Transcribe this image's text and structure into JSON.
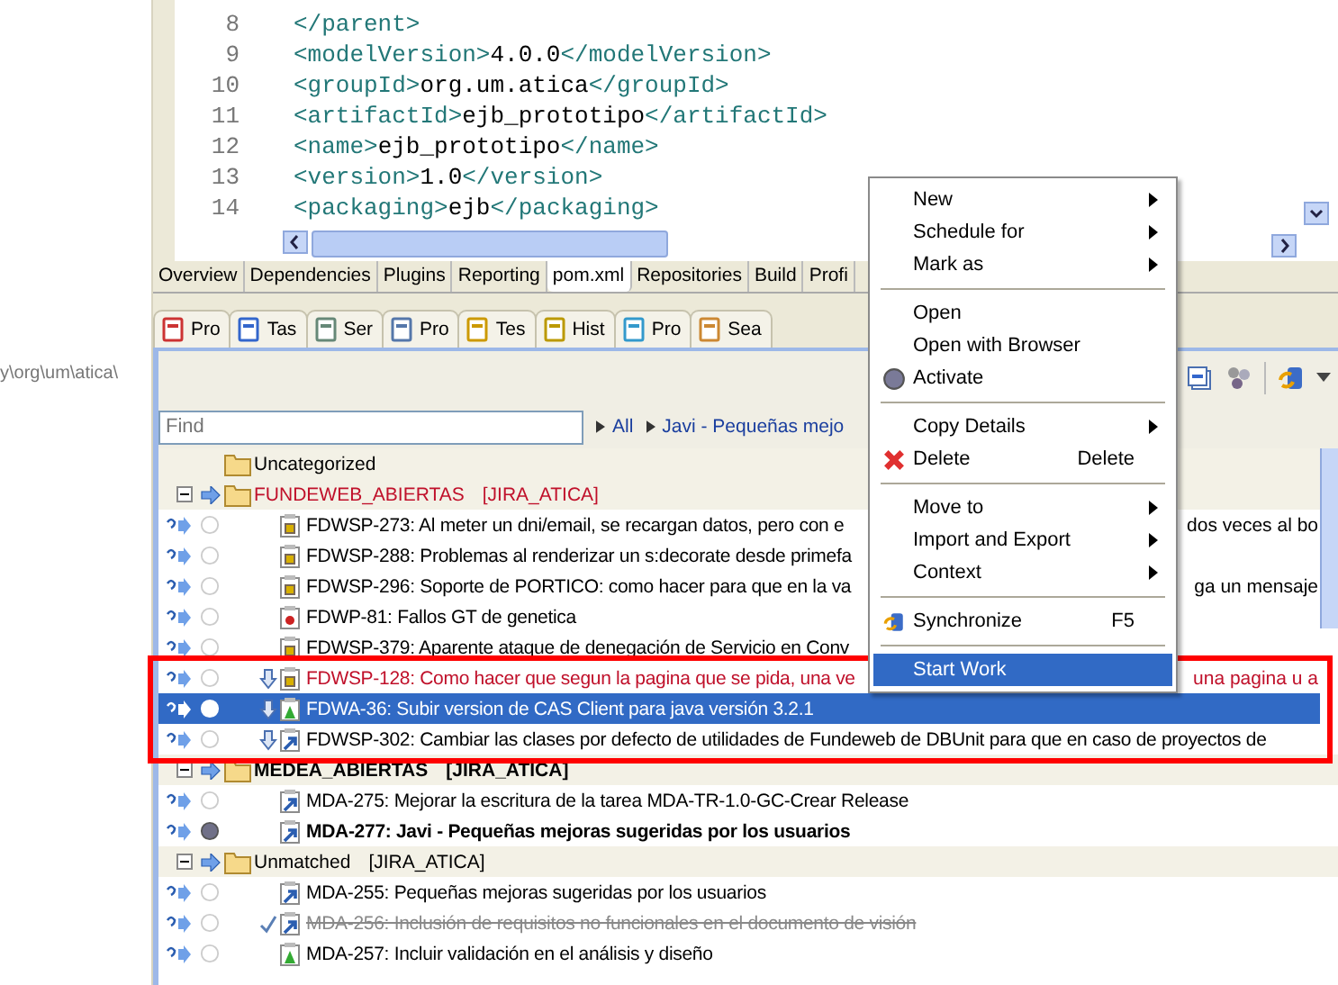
{
  "path_strip": {
    "text": "y\\org\\um\\atica\\"
  },
  "editor": {
    "lines": [
      {
        "number": "8",
        "open": "</parent>"
      },
      {
        "number": "9",
        "open": "<modelVersion>",
        "value": "4.0.0",
        "close": "</modelVersion>"
      },
      {
        "number": "10",
        "open": "<groupId>",
        "value": "org.um.atica",
        "close": "</groupId>"
      },
      {
        "number": "11",
        "open": "<artifactId>",
        "value": "ejb_prototipo",
        "close": "</artifactId>"
      },
      {
        "number": "12",
        "open": "<name>",
        "value": "ejb_prototipo",
        "close": "</name>"
      },
      {
        "number": "13",
        "open": "<version>",
        "value": "1.0",
        "close": "</version>"
      },
      {
        "number": "14",
        "open": "<packaging>",
        "value": "ejb",
        "close": "</packaging>"
      }
    ],
    "tabs": [
      {
        "label": "Overview",
        "selected": false
      },
      {
        "label": "Dependencies",
        "selected": false
      },
      {
        "label": "Plugins",
        "selected": false
      },
      {
        "label": "Reporting",
        "selected": false
      },
      {
        "label": "pom.xml",
        "selected": true
      },
      {
        "label": "Repositories",
        "selected": false
      },
      {
        "label": "Build",
        "selected": false
      },
      {
        "label": "Profi",
        "selected": false
      }
    ]
  },
  "view_tabs": [
    {
      "label": "Pro",
      "kind": "problems"
    },
    {
      "label": "Tas",
      "kind": "tasks"
    },
    {
      "label": "Ser",
      "kind": "servers"
    },
    {
      "label": "Pro",
      "kind": "properties"
    },
    {
      "label": "Tes",
      "kind": "testng"
    },
    {
      "label": "Hist",
      "kind": "history"
    },
    {
      "label": "Pro",
      "kind": "progress"
    },
    {
      "label": "Sea",
      "kind": "search"
    }
  ],
  "find": {
    "placeholder": "Find",
    "breadcrumbs": [
      "All",
      "Javi - Pequeñas mejo"
    ]
  },
  "tree": [
    {
      "kind": "local",
      "label": "Uncategorized",
      "overdue": false,
      "active": false
    },
    {
      "kind": "query",
      "label": "FUNDEWEB_ABIERTAS",
      "tag": "[JIRA_ATICA]",
      "expanded": true,
      "overdue": true,
      "active": false,
      "children": [
        {
          "kind": "task",
          "label": "FDWSP-273: Al meter un dni/email, se recargan datos, pero con e",
          "tail": "dos veces al bo",
          "incoming": false,
          "active": false,
          "selected": false,
          "completed": false,
          "overdue": false
        },
        {
          "kind": "task",
          "label": "FDWSP-288: Problemas al renderizar un s:decorate desde primefa",
          "incoming": false,
          "active": false,
          "selected": false,
          "completed": false,
          "overdue": false
        },
        {
          "kind": "task",
          "label": "FDWSP-296: Soporte de PORTICO: como hacer para que en la va",
          "tail": "ga un mensaje",
          "incoming": false,
          "active": false,
          "selected": false,
          "completed": false,
          "overdue": false
        },
        {
          "kind": "bug",
          "label": "FDWP-81: Fallos GT de genetica",
          "incoming": false,
          "active": false,
          "selected": false,
          "completed": false,
          "overdue": false
        },
        {
          "kind": "task",
          "label": "FDWSP-379: Aparente ataque de denegación de Servicio en Conv",
          "incoming": false,
          "active": false,
          "selected": false,
          "completed": false,
          "overdue": false
        },
        {
          "kind": "task",
          "label": "FDWSP-128: Como hacer que segun la pagina que se pida, una ve",
          "tail": "una pagina u a",
          "incoming": true,
          "active": false,
          "selected": false,
          "completed": false,
          "overdue": true
        },
        {
          "kind": "feature",
          "label": "FDWA-36: Subir version de CAS Client para java versión 3.2.1",
          "incoming": true,
          "active": true,
          "selected": true,
          "completed": false,
          "overdue": false
        },
        {
          "kind": "improvement",
          "label": "FDWSP-302: Cambiar las clases por defecto de utilidades de Fundeweb de DBUnit para que en caso de proyectos de",
          "incoming": true,
          "active": false,
          "selected": false,
          "completed": false,
          "overdue": false
        }
      ]
    },
    {
      "kind": "query",
      "label": "MEDEA_ABIERTAS",
      "tag": "[JIRA_ATICA]",
      "expanded": true,
      "overdue": false,
      "active": true,
      "children": [
        {
          "kind": "improvement",
          "label": "MDA-275: Mejorar la escritura de la tarea MDA-TR-1.0-GC-Crear Release",
          "incoming": false,
          "active": false,
          "selected": false,
          "completed": false,
          "overdue": false
        },
        {
          "kind": "improvement",
          "label": "MDA-277: Javi - Pequeñas mejoras sugeridas por los usuarios",
          "incoming": false,
          "active": true,
          "selected": false,
          "completed": false,
          "overdue": false
        }
      ]
    },
    {
      "kind": "query",
      "label": "Unmatched",
      "tag": "[JIRA_ATICA]",
      "expanded": true,
      "overdue": false,
      "active": false,
      "children": [
        {
          "kind": "improvement",
          "label": "MDA-255: Pequeñas mejoras sugeridas por los usuarios",
          "incoming": false,
          "active": false,
          "selected": false,
          "completed": false,
          "overdue": false
        },
        {
          "kind": "improvement",
          "label": "MDA-256: Inclusión de requisitos no funcionales en el documento de visión",
          "incoming": false,
          "active": false,
          "selected": false,
          "completed": true,
          "overdue": false
        },
        {
          "kind": "feature",
          "label": "MDA-257: Incluir validación en el análisis y diseño",
          "incoming": false,
          "active": false,
          "selected": false,
          "completed": false,
          "overdue": false
        }
      ]
    }
  ],
  "context_menu": [
    {
      "kind": "item",
      "label": "New",
      "submenu": true,
      "selected": false
    },
    {
      "kind": "item",
      "label": "Schedule for",
      "submenu": true,
      "selected": false
    },
    {
      "kind": "item",
      "label": "Mark as",
      "submenu": true,
      "selected": false
    },
    {
      "kind": "separator"
    },
    {
      "kind": "item",
      "label": "Open",
      "submenu": false,
      "selected": false
    },
    {
      "kind": "item",
      "label": "Open with Browser",
      "submenu": false,
      "selected": false
    },
    {
      "kind": "activate",
      "label": "Activate",
      "submenu": false,
      "selected": false
    },
    {
      "kind": "separator"
    },
    {
      "kind": "item",
      "label": "Copy Details",
      "submenu": true,
      "selected": false
    },
    {
      "kind": "delete",
      "label": "Delete",
      "shortcut": "Delete",
      "submenu": false,
      "selected": false
    },
    {
      "kind": "separator"
    },
    {
      "kind": "item",
      "label": "Move to",
      "submenu": true,
      "selected": false
    },
    {
      "kind": "item",
      "label": "Import and Export",
      "submenu": true,
      "selected": false
    },
    {
      "kind": "item",
      "label": "Context",
      "submenu": true,
      "selected": false
    },
    {
      "kind": "separator"
    },
    {
      "kind": "synchronize",
      "label": "Synchronize",
      "shortcut": "F5",
      "submenu": false,
      "selected": false
    },
    {
      "kind": "separator"
    },
    {
      "kind": "item",
      "label": "Start Work",
      "submenu": false,
      "selected": true
    }
  ]
}
